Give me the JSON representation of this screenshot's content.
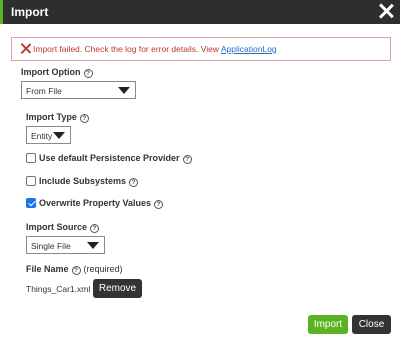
{
  "dialog": {
    "title": "Import"
  },
  "error": {
    "message": "Import failed. Check the log for error details. View ",
    "link": "ApplicationLog"
  },
  "import_option": {
    "label": "Import Option",
    "value": "From File"
  },
  "import_type": {
    "label": "Import Type",
    "value": "Entity"
  },
  "checkboxes": [
    {
      "label": "Use default Persistence Provider",
      "checked": false
    },
    {
      "label": "Include Subsystems",
      "checked": false
    },
    {
      "label": "Overwrite Property Values",
      "checked": true
    }
  ],
  "import_source": {
    "label": "Import Source",
    "value": "Single File"
  },
  "file_name": {
    "label": "File Name",
    "required": "(required)",
    "value": "Things_Car1.xml",
    "remove_label": "Remove"
  },
  "footer": {
    "import_label": "Import",
    "close_label": "Close"
  },
  "colors": {
    "titlebar": "#2d2e30",
    "accent_green": "#5bb323",
    "error_red": "#c0392b",
    "link_blue": "#2a6dc2",
    "checkbox_blue": "#1a73e8"
  }
}
